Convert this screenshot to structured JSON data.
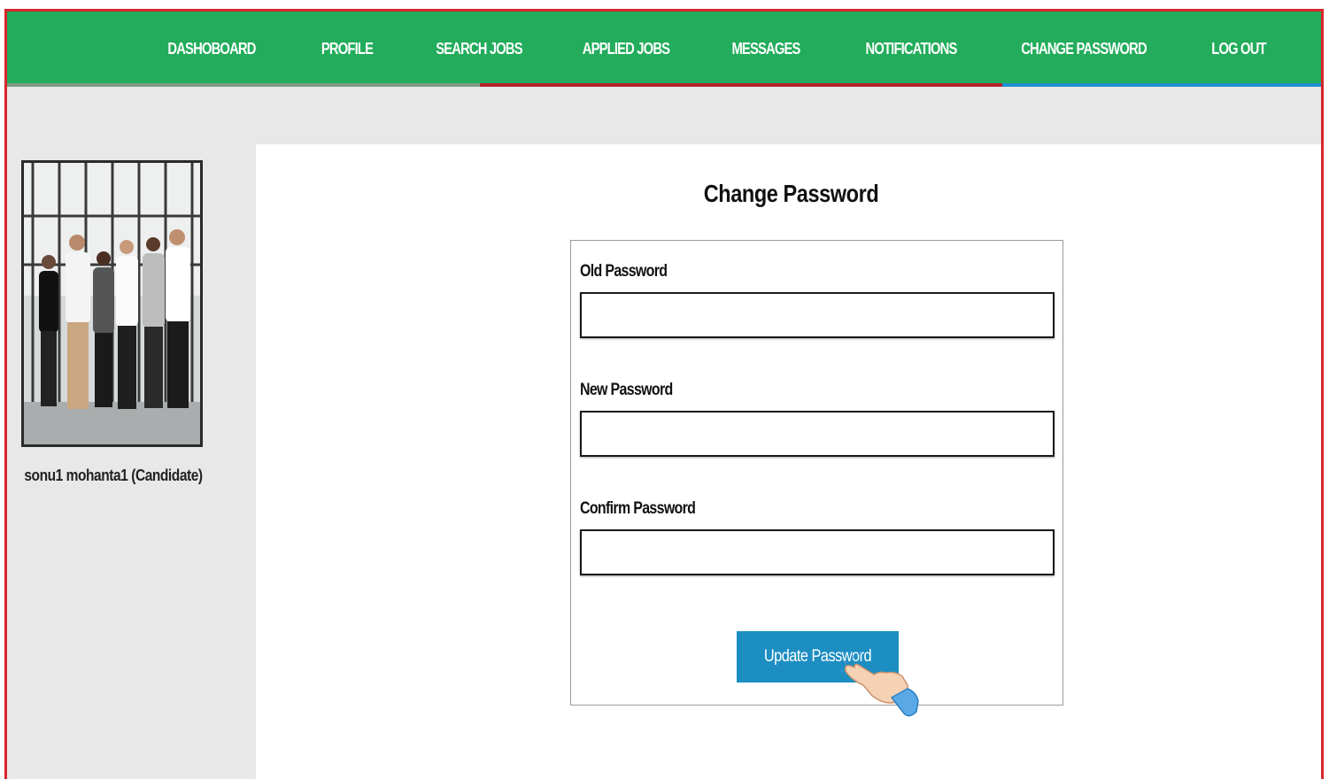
{
  "nav": {
    "items": [
      {
        "label": "DASHOBOARD"
      },
      {
        "label": "PROFILE"
      },
      {
        "label": "SEARCH JOBS"
      },
      {
        "label": "APPLIED JOBS"
      },
      {
        "label": "MESSAGES"
      },
      {
        "label": "NOTIFICATIONS"
      },
      {
        "label": "CHANGE PASSWORD"
      },
      {
        "label": "LOG OUT"
      }
    ],
    "active": "CHANGE PASSWORD"
  },
  "sidebar": {
    "user_name": "sonu1 mohanta1 (Candidate)"
  },
  "main": {
    "title": "Change Password",
    "fields": [
      {
        "label": "Old Password",
        "value": ""
      },
      {
        "label": "New Password",
        "value": ""
      },
      {
        "label": "Confirm Password",
        "value": ""
      }
    ],
    "submit_label": "Update Password"
  },
  "colors": {
    "nav_bg": "#22ac5b",
    "frame_border": "#d9252b",
    "button_bg": "#1c8ec2",
    "page_bg": "#e8e8e8"
  }
}
